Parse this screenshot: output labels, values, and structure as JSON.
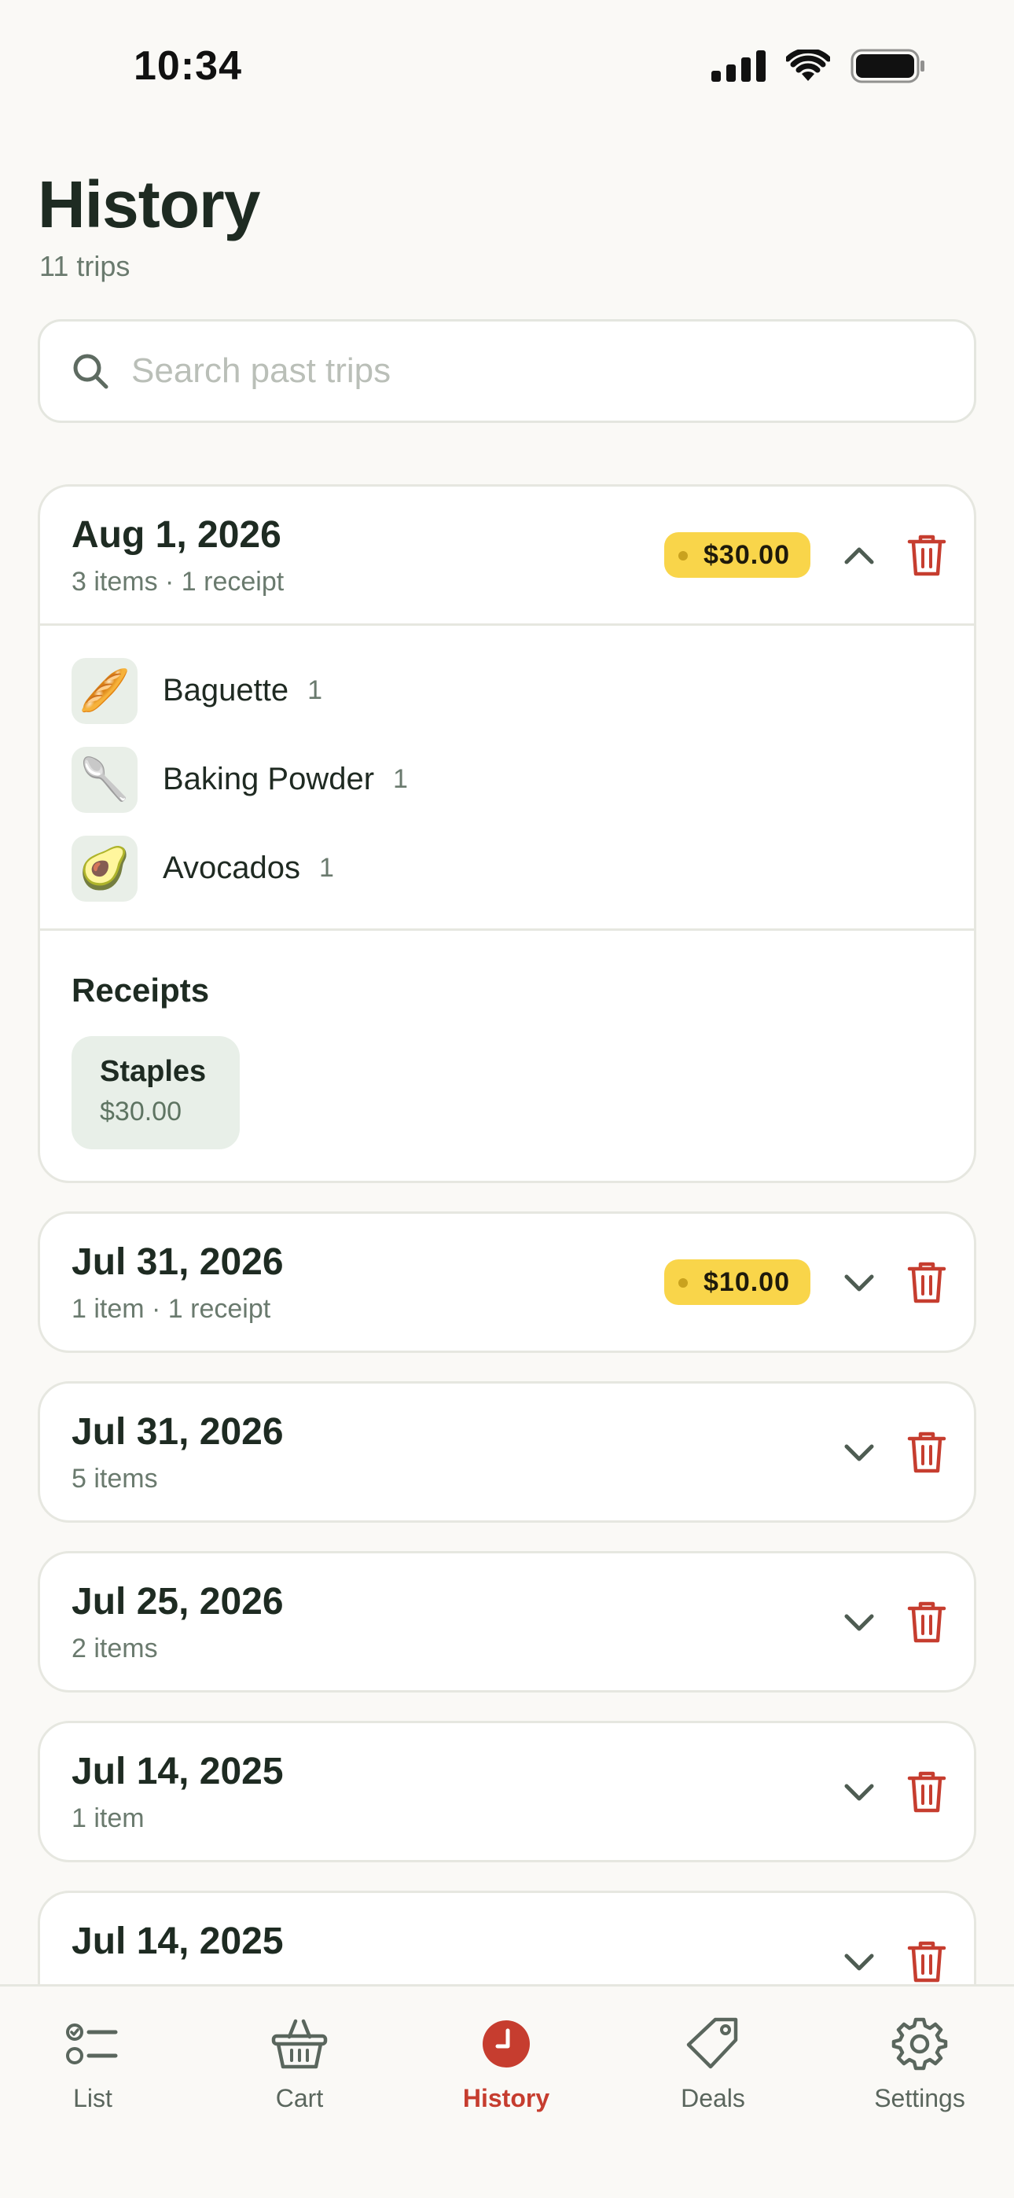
{
  "status_bar": {
    "time": "10:34"
  },
  "header": {
    "title": "History",
    "subtitle": "11 trips"
  },
  "search": {
    "placeholder": "Search past trips",
    "value": ""
  },
  "trips": [
    {
      "date": "Aug 1, 2026",
      "meta": "3 items · 1 receipt",
      "total": "$30.00",
      "expanded": true,
      "items": [
        {
          "emoji": "🥖",
          "name": "Baguette",
          "qty": "1"
        },
        {
          "emoji": "🥄",
          "name": "Baking Powder",
          "qty": "1"
        },
        {
          "emoji": "🥑",
          "name": "Avocados",
          "qty": "1"
        }
      ],
      "receipts_title": "Receipts",
      "receipts": [
        {
          "store": "Staples",
          "amount": "$30.00"
        }
      ]
    },
    {
      "date": "Jul 31, 2026",
      "meta": "1 item · 1 receipt",
      "total": "$10.00",
      "expanded": false
    },
    {
      "date": "Jul 31, 2026",
      "meta": "5 items",
      "expanded": false
    },
    {
      "date": "Jul 25, 2026",
      "meta": "2 items",
      "expanded": false
    },
    {
      "date": "Jul 14, 2025",
      "meta": "1 item",
      "expanded": false
    },
    {
      "date": "Jul 14, 2025",
      "meta": "",
      "expanded": false
    }
  ],
  "tab_bar": {
    "tabs": [
      {
        "label": "List",
        "icon": "list-icon"
      },
      {
        "label": "Cart",
        "icon": "basket-icon"
      },
      {
        "label": "History",
        "icon": "clock-icon",
        "active": true
      },
      {
        "label": "Deals",
        "icon": "tag-icon"
      },
      {
        "label": "Settings",
        "icon": "gear-icon"
      }
    ]
  },
  "colors": {
    "accent": "#C63D2F",
    "badge": "#F9D54A",
    "background": "#FAF9F6",
    "card": "#FFFFFF",
    "chip": "#E8EFE8"
  }
}
